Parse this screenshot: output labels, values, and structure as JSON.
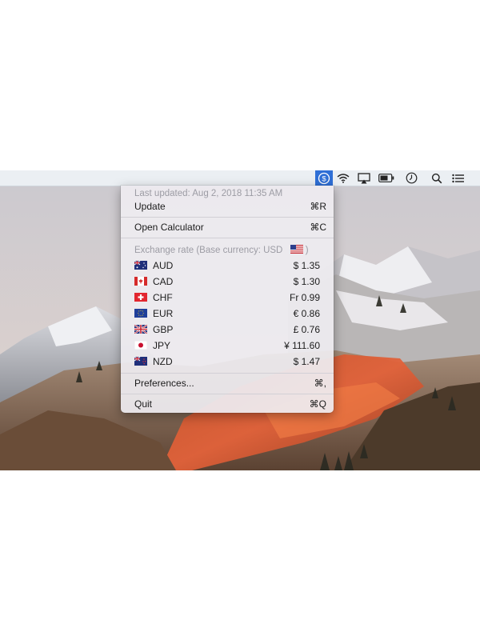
{
  "menubar": {
    "icons": [
      "currency-converter-icon",
      "wifi-icon",
      "airplay-icon",
      "battery-icon",
      "clock-icon",
      "spotlight-search-icon",
      "notification-center-icon"
    ],
    "active_color": "#2f6fd6"
  },
  "menu": {
    "last_updated": "Last updated: Aug 2, 2018 11:35 AM",
    "update_label": "Update",
    "update_shortcut": "⌘R",
    "calculator_label": "Open Calculator",
    "calculator_shortcut": "⌘C",
    "exchange_header_prefix": "Exchange rate (Base currency:  USD",
    "exchange_header_suffix": ")",
    "rates": [
      {
        "code": "AUD",
        "value": "$ 1.35",
        "flag": "australia-flag-icon"
      },
      {
        "code": "CAD",
        "value": "$ 1.30",
        "flag": "canada-flag-icon"
      },
      {
        "code": "CHF",
        "value": "Fr 0.99",
        "flag": "switzerland-flag-icon"
      },
      {
        "code": "EUR",
        "value": "€ 0.86",
        "flag": "eu-flag-icon"
      },
      {
        "code": "GBP",
        "value": "£ 0.76",
        "flag": "uk-flag-icon"
      },
      {
        "code": "JPY",
        "value": "¥ 111.60",
        "flag": "japan-flag-icon"
      },
      {
        "code": "NZD",
        "value": "$ 1.47",
        "flag": "new-zealand-flag-icon"
      }
    ],
    "preferences_label": "Preferences...",
    "preferences_shortcut": "⌘,",
    "quit_label": "Quit",
    "quit_shortcut": "⌘Q"
  }
}
